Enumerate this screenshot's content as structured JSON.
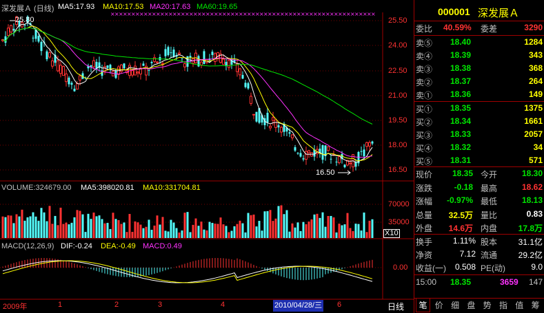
{
  "kline": {
    "title": "深发展Ａ (日线)",
    "ma5": "MA5:17.93",
    "ma10": "MA10:17.53",
    "ma20": "MA20:17.63",
    "ma60": "MA60:19.65",
    "high_marker": "25.80",
    "low_marker": "16.50",
    "y_ticks": [
      "25.50",
      "24.00",
      "22.50",
      "21.00",
      "19.50",
      "18.00",
      "16.50"
    ]
  },
  "volume": {
    "label": "VOLUME:324679.00",
    "ma5": "MA5:398020.81",
    "ma10": "MA10:331704.81",
    "y_ticks": [
      "70000",
      "35000"
    ],
    "unit": "X10"
  },
  "macd": {
    "label": "MACD(12,26,9)",
    "dif": "DIF:-0.24",
    "dea": "DEA:-0.49",
    "macd": "MACD:0.49",
    "y_tick": "0.00"
  },
  "date_axis": {
    "year": "2009年",
    "months": [
      "1",
      "2",
      "3",
      "4",
      "6"
    ],
    "cursor_date": "2010/04/28/三",
    "period": "日线"
  },
  "quote": {
    "code": "000001",
    "name": "深发展Ａ",
    "weibi_label": "委比",
    "weibi": "40.59%",
    "weicha_label": "委差",
    "weicha": "3290",
    "asks": [
      {
        "label": "卖⑤",
        "price": "18.40",
        "vol": "1284"
      },
      {
        "label": "卖④",
        "price": "18.39",
        "vol": "343"
      },
      {
        "label": "卖③",
        "price": "18.38",
        "vol": "368"
      },
      {
        "label": "卖②",
        "price": "18.37",
        "vol": "264"
      },
      {
        "label": "卖①",
        "price": "18.36",
        "vol": "149"
      }
    ],
    "bids": [
      {
        "label": "买①",
        "price": "18.35",
        "vol": "1375"
      },
      {
        "label": "买②",
        "price": "18.34",
        "vol": "1661"
      },
      {
        "label": "买③",
        "price": "18.33",
        "vol": "2057"
      },
      {
        "label": "买④",
        "price": "18.32",
        "vol": "34"
      },
      {
        "label": "买⑤",
        "price": "18.31",
        "vol": "571"
      }
    ],
    "stats": [
      {
        "l1": "现价",
        "v1": "18.35",
        "l2": "今开",
        "v2": "18.30"
      },
      {
        "l1": "涨跌",
        "v1": "-0.18",
        "l2": "最高",
        "v2": "18.62"
      },
      {
        "l1": "涨幅",
        "v1": "-0.97%",
        "l2": "最低",
        "v2": "18.13"
      },
      {
        "l1": "总量",
        "v1": "32.5万",
        "l2": "量比",
        "v2": "0.83"
      },
      {
        "l1": "外盘",
        "v1": "14.6万",
        "l2": "内盘",
        "v2": "17.8万"
      }
    ],
    "finance": [
      {
        "l1": "换手",
        "v1": "1.11%",
        "l2": "股本",
        "v2": "31.1亿"
      },
      {
        "l1": "净资",
        "v1": "7.12",
        "l2": "流通",
        "v2": "29.2亿"
      },
      {
        "l1": "收益(一)",
        "v1": "0.508",
        "l2": "PE(动)",
        "v2": "9.0"
      }
    ],
    "tick": {
      "time": "15:00",
      "price": "18.35",
      "vol": "3659",
      "num": "147"
    }
  },
  "tabs": [
    "笔",
    "价",
    "细",
    "盘",
    "势",
    "指",
    "值",
    "筹"
  ]
}
